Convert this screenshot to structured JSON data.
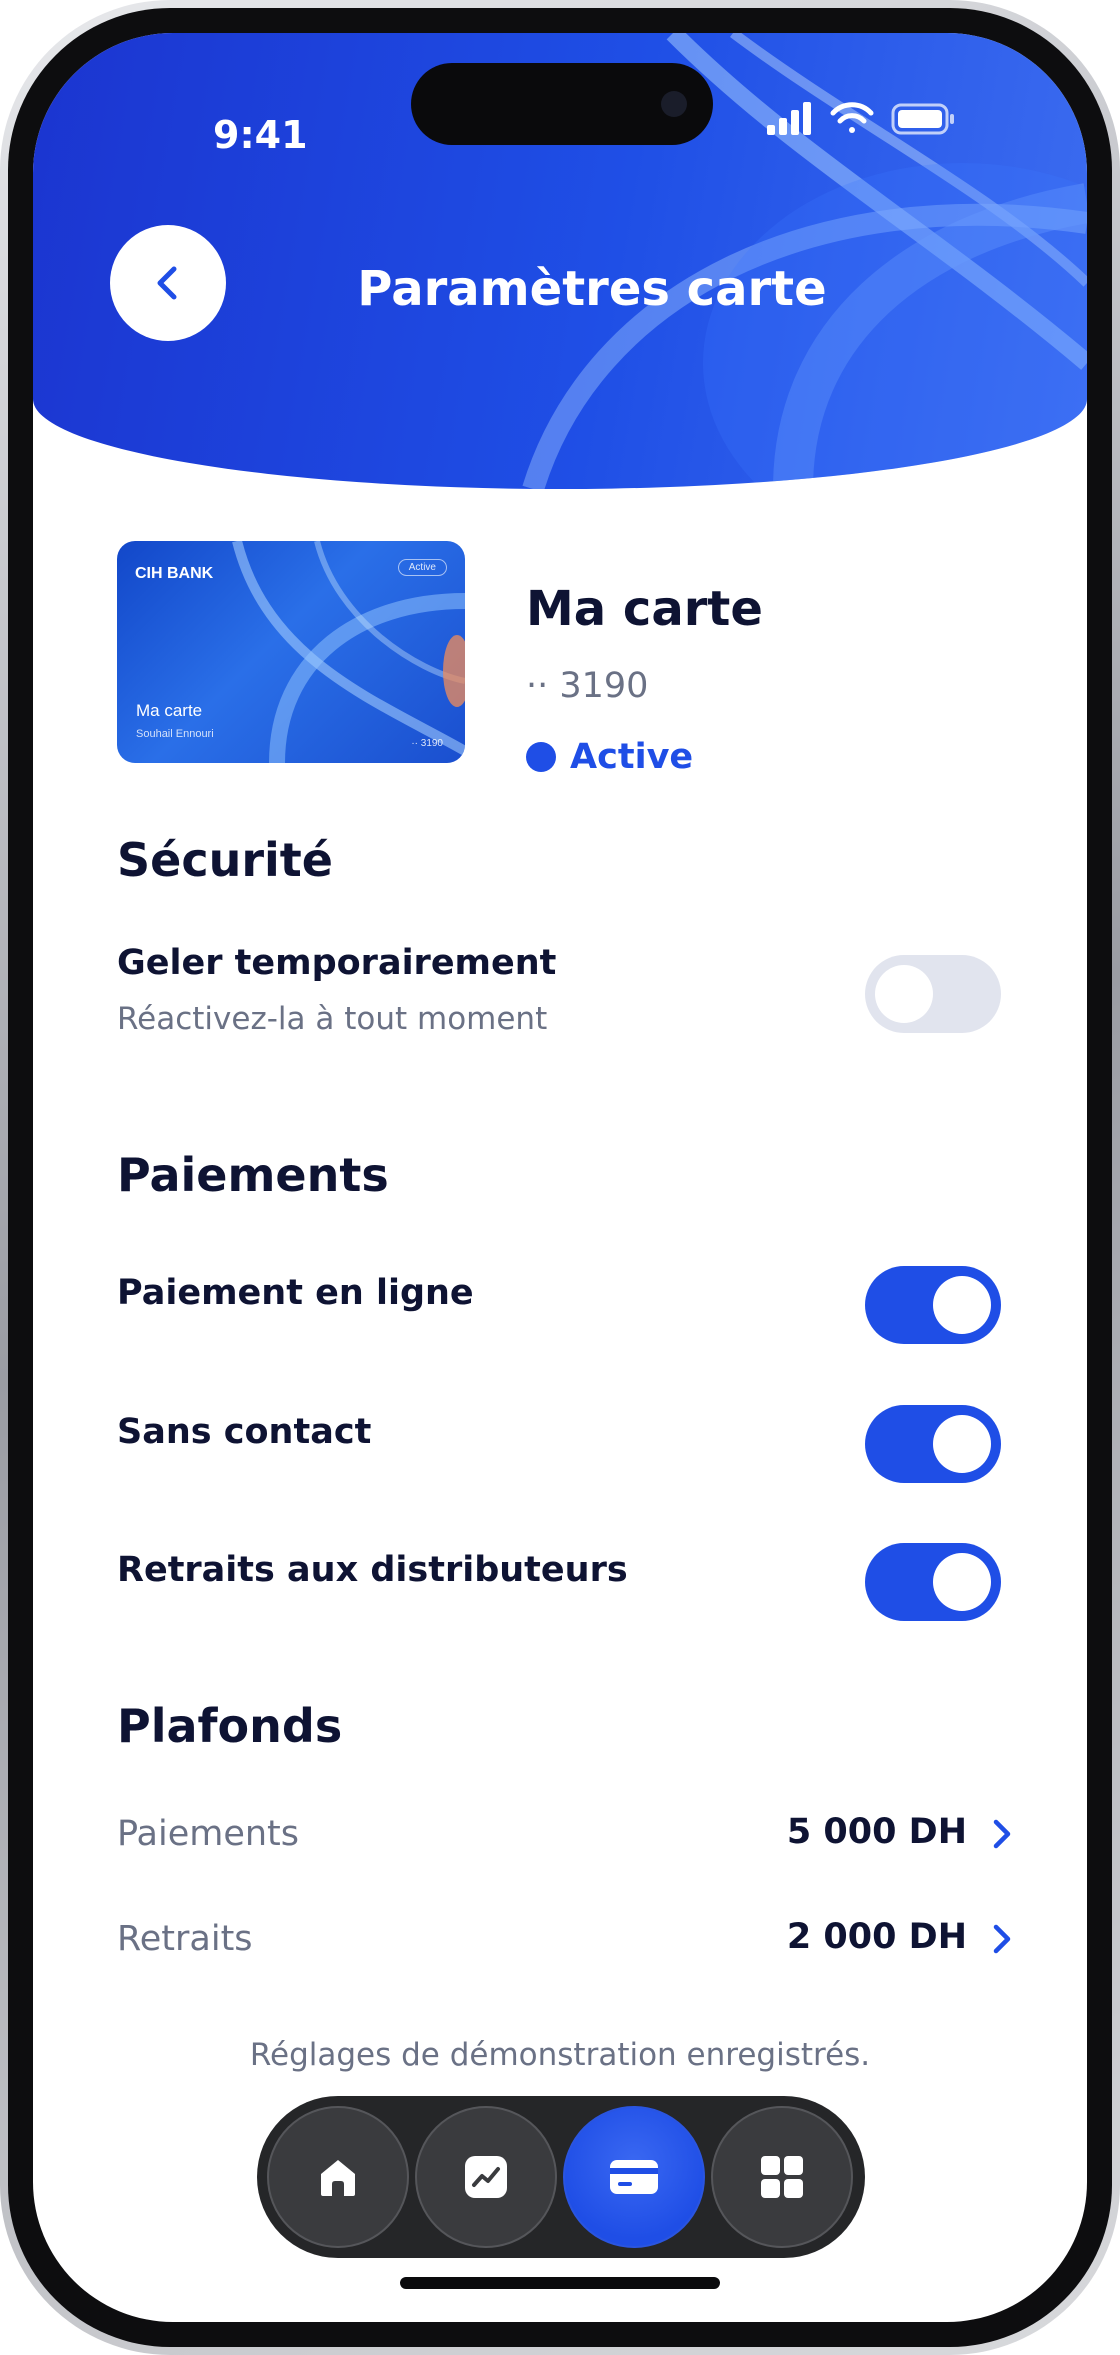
{
  "status_bar": {
    "time": "9:41"
  },
  "header": {
    "title": "Paramètres carte",
    "back_icon": "chevron-left-icon"
  },
  "card": {
    "bank": "CIH BANK",
    "badge": "Active",
    "name": "Ma carte",
    "holder": "Souhail Ennouri",
    "last4": "·· 3190",
    "title": "Ma carte",
    "number": "·· 3190",
    "status": "Active"
  },
  "security": {
    "title": "Sécurité",
    "freeze": {
      "label": "Geler temporairement",
      "sub": "Réactivez-la à tout moment",
      "enabled": false
    }
  },
  "payments": {
    "title": "Paiements",
    "items": [
      {
        "label": "Paiement en ligne",
        "enabled": true
      },
      {
        "label": "Sans contact",
        "enabled": true
      },
      {
        "label": "Retraits aux distributeurs",
        "enabled": true
      }
    ]
  },
  "limits": {
    "title": "Plafonds",
    "items": [
      {
        "label": "Paiements",
        "value": "5 000 DH"
      },
      {
        "label": "Retraits",
        "value": "2 000 DH"
      }
    ]
  },
  "note": "Réglages de démonstration enregistrés.",
  "nav": {
    "items": [
      {
        "icon": "home-icon",
        "active": false
      },
      {
        "icon": "chart-icon",
        "active": false
      },
      {
        "icon": "card-icon",
        "active": true
      },
      {
        "icon": "grid-icon",
        "active": false
      }
    ]
  },
  "colors": {
    "accent": "#1f4ee6",
    "text": "#0e1333",
    "muted": "#6a7185",
    "toggle_off": "#e1e4ee",
    "nav_bg": "#252628"
  }
}
